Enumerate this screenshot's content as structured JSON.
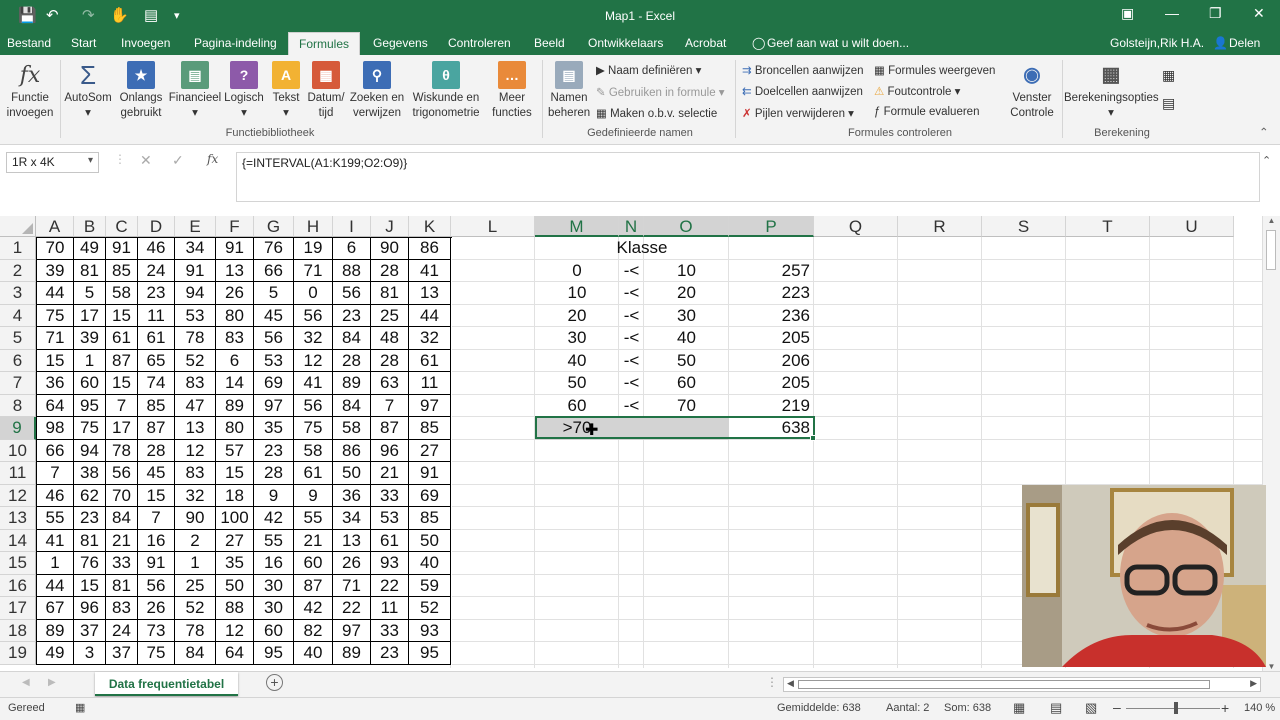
{
  "window": {
    "title": "Map1 - Excel",
    "user": "Golsteijn,Rik H.A.",
    "share": "Delen"
  },
  "tabs": [
    "Bestand",
    "Start",
    "Invoegen",
    "Pagina-indeling",
    "Formules",
    "Gegevens",
    "Controleren",
    "Beeld",
    "Ontwikkelaars",
    "Acrobat"
  ],
  "active_tab": "Formules",
  "tell_me": "Geef aan wat u wilt doen...",
  "ribbon": {
    "insert_function": "Functie invoegen",
    "autosum": "AutoSom",
    "recent": "Onlangs gebruikt",
    "financial": "Financieel",
    "logical": "Logisch",
    "text": "Tekst",
    "datetime": "Datum/ tijd",
    "lookup": "Zoeken en verwijzen",
    "math": "Wiskunde en trigonometrie",
    "more": "Meer functies",
    "group_library": "Functiebibliotheek",
    "name_manager": "Namen beheren",
    "define_name": "Naam definiëren",
    "use_in_formula": "Gebruiken in formule",
    "create_from_selection": "Maken o.b.v. selectie",
    "group_names": "Gedefinieerde namen",
    "trace_precedents": "Broncellen aanwijzen",
    "trace_dependents": "Doelcellen aanwijzen",
    "remove_arrows": "Pijlen verwijderen",
    "show_formulas": "Formules weergeven",
    "error_checking": "Foutcontrole",
    "evaluate_formula": "Formule evalueren",
    "watch_window": "Venster Controle",
    "group_auditing": "Formules controleren",
    "calc_options": "Berekeningsopties",
    "group_calc": "Berekening"
  },
  "namebox": "1R x 4K",
  "formula": "{=INTERVAL(A1:K199;O2:O9)}",
  "columns": [
    "A",
    "B",
    "C",
    "D",
    "E",
    "F",
    "G",
    "H",
    "I",
    "J",
    "K",
    "L",
    "M",
    "N",
    "O",
    "P",
    "Q",
    "R",
    "S",
    "T",
    "U"
  ],
  "rows": [
    "1",
    "2",
    "3",
    "4",
    "5",
    "6",
    "7",
    "8",
    "9",
    "10",
    "11",
    "12",
    "13",
    "14",
    "15",
    "16",
    "17",
    "18",
    "19"
  ],
  "data": [
    [
      "70",
      "49",
      "91",
      "46",
      "34",
      "91",
      "76",
      "19",
      "6",
      "90",
      "86"
    ],
    [
      "39",
      "81",
      "85",
      "24",
      "91",
      "13",
      "66",
      "71",
      "88",
      "28",
      "41"
    ],
    [
      "44",
      "5",
      "58",
      "23",
      "94",
      "26",
      "5",
      "0",
      "56",
      "81",
      "13"
    ],
    [
      "75",
      "17",
      "15",
      "11",
      "53",
      "80",
      "45",
      "56",
      "23",
      "25",
      "44"
    ],
    [
      "71",
      "39",
      "61",
      "61",
      "78",
      "83",
      "56",
      "32",
      "84",
      "48",
      "32"
    ],
    [
      "15",
      "1",
      "87",
      "65",
      "52",
      "6",
      "53",
      "12",
      "28",
      "28",
      "61"
    ],
    [
      "36",
      "60",
      "15",
      "74",
      "83",
      "14",
      "69",
      "41",
      "89",
      "63",
      "11"
    ],
    [
      "64",
      "95",
      "7",
      "85",
      "47",
      "89",
      "97",
      "56",
      "84",
      "7",
      "97"
    ],
    [
      "98",
      "75",
      "17",
      "87",
      "13",
      "80",
      "35",
      "75",
      "58",
      "87",
      "85"
    ],
    [
      "66",
      "94",
      "78",
      "28",
      "12",
      "57",
      "23",
      "58",
      "86",
      "96",
      "27"
    ],
    [
      "7",
      "38",
      "56",
      "45",
      "83",
      "15",
      "28",
      "61",
      "50",
      "21",
      "91"
    ],
    [
      "46",
      "62",
      "70",
      "15",
      "32",
      "18",
      "9",
      "9",
      "36",
      "33",
      "69"
    ],
    [
      "55",
      "23",
      "84",
      "7",
      "90",
      "100",
      "42",
      "55",
      "34",
      "53",
      "85"
    ],
    [
      "41",
      "81",
      "21",
      "16",
      "2",
      "27",
      "55",
      "21",
      "13",
      "61",
      "50"
    ],
    [
      "1",
      "76",
      "33",
      "91",
      "1",
      "35",
      "16",
      "60",
      "26",
      "93",
      "40"
    ],
    [
      "44",
      "15",
      "81",
      "56",
      "25",
      "50",
      "30",
      "87",
      "71",
      "22",
      "59"
    ],
    [
      "67",
      "96",
      "83",
      "26",
      "52",
      "88",
      "30",
      "42",
      "22",
      "11",
      "52"
    ],
    [
      "89",
      "37",
      "24",
      "73",
      "78",
      "12",
      "60",
      "82",
      "97",
      "33",
      "93"
    ],
    [
      "49",
      "3",
      "37",
      "75",
      "84",
      "64",
      "95",
      "40",
      "89",
      "23",
      "95"
    ]
  ],
  "klasse": {
    "header": "Klasse",
    "sep": "-<",
    "rows": [
      [
        "0",
        "10",
        "257"
      ],
      [
        "10",
        "20",
        "223"
      ],
      [
        "20",
        "30",
        "236"
      ],
      [
        "30",
        "40",
        "205"
      ],
      [
        "40",
        "50",
        "206"
      ],
      [
        "50",
        "60",
        "205"
      ],
      [
        "60",
        "70",
        "219"
      ]
    ],
    "last": [
      ">70",
      "638"
    ]
  },
  "sheet_tab": "Data frequentietabel",
  "status": {
    "ready": "Gereed",
    "avg": "Gemiddelde: 638",
    "count": "Aantal: 2",
    "sum": "Som: 638",
    "zoom": "140 %"
  }
}
